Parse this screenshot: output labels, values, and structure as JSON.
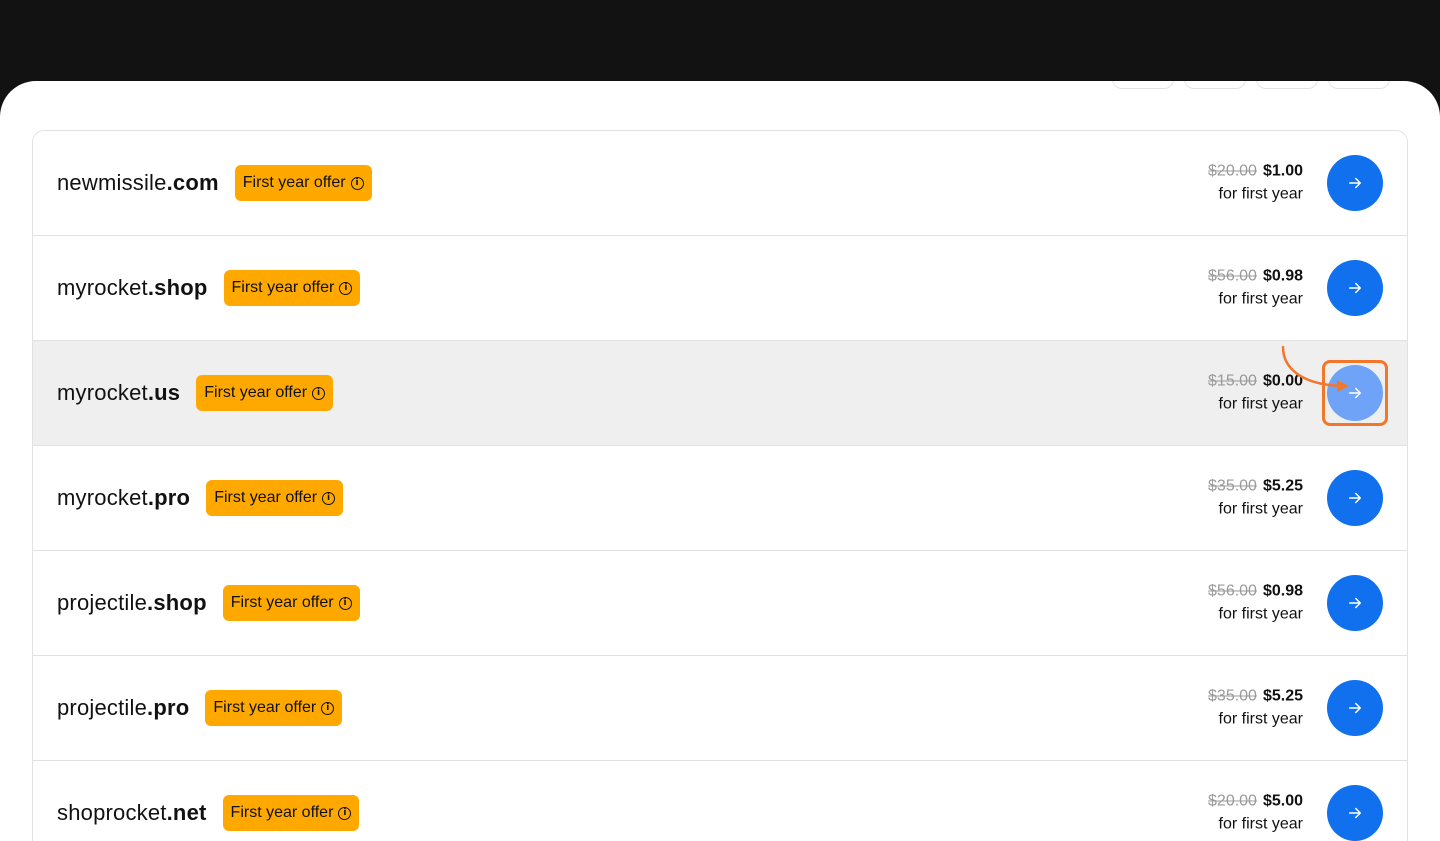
{
  "badge_label": "First year offer",
  "period_label": "for first year",
  "colors": {
    "primary_button": "#1170ee",
    "hover_button": "#6fa3f7",
    "badge": "#ffa800",
    "focus_ring": "#f2772a"
  },
  "domains": [
    {
      "name": "newmissile",
      "tld": ".com",
      "old_price": "$20.00",
      "new_price": "$1.00"
    },
    {
      "name": "myrocket",
      "tld": ".shop",
      "old_price": "$56.00",
      "new_price": "$0.98"
    },
    {
      "name": "myrocket",
      "tld": ".us",
      "old_price": "$15.00",
      "new_price": "$0.00"
    },
    {
      "name": "myrocket",
      "tld": ".pro",
      "old_price": "$35.00",
      "new_price": "$5.25"
    },
    {
      "name": "projectile",
      "tld": ".shop",
      "old_price": "$56.00",
      "new_price": "$0.98"
    },
    {
      "name": "projectile",
      "tld": ".pro",
      "old_price": "$35.00",
      "new_price": "$5.25"
    },
    {
      "name": "shoprocket",
      "tld": ".net",
      "old_price": "$20.00",
      "new_price": "$5.00"
    }
  ]
}
